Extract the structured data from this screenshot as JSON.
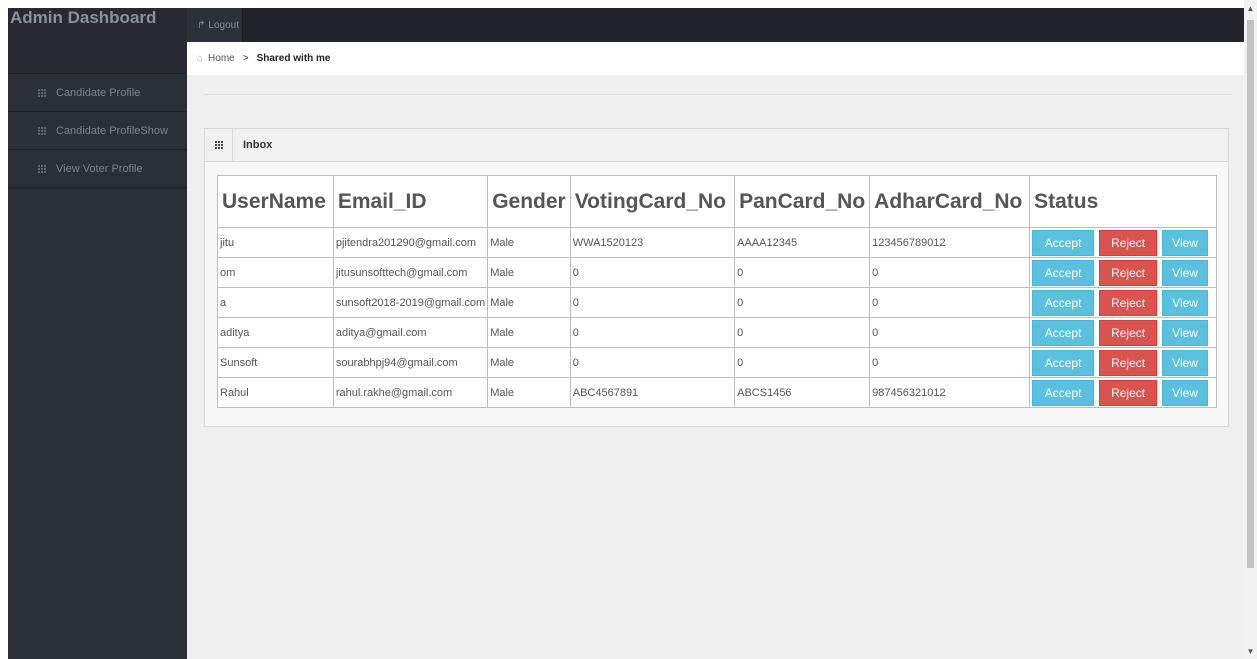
{
  "brand": {
    "title": "Admin Dashboard"
  },
  "topbar": {
    "logout_label": "Logout"
  },
  "breadcrumb": {
    "home": "Home",
    "separator": ">",
    "current": "Shared with me"
  },
  "sidebar": {
    "items": [
      {
        "label": "Candidate Profile"
      },
      {
        "label": "Candidate ProfileShow"
      },
      {
        "label": "View Voter Profile"
      }
    ]
  },
  "panel": {
    "title": "Inbox"
  },
  "table": {
    "headers": [
      "UserName",
      "Email_ID",
      "Gender",
      "VotingCard_No",
      "PanCard_No",
      "AdharCard_No",
      "Status"
    ],
    "rows": [
      {
        "username": "jitu",
        "email": "pjitendra201290@gmail.com",
        "gender": "Male",
        "voting": "WWA1520123",
        "pan": "AAAA12345",
        "adhar": "123456789012"
      },
      {
        "username": "om",
        "email": "jitusunsofttech@gmail.com",
        "gender": "Male",
        "voting": "0",
        "pan": "0",
        "adhar": "0"
      },
      {
        "username": "a",
        "email": "sunsoft2018-2019@gmail.com",
        "gender": "Male",
        "voting": "0",
        "pan": "0",
        "adhar": "0"
      },
      {
        "username": "aditya",
        "email": "aditya@gmail.com",
        "gender": "Male",
        "voting": "0",
        "pan": "0",
        "adhar": "0"
      },
      {
        "username": "Sunsoft",
        "email": "sourabhpj94@gmail.com",
        "gender": "Male",
        "voting": "0",
        "pan": "0",
        "adhar": "0"
      },
      {
        "username": "Rahul",
        "email": "rahul.rakhe@gmail.com",
        "gender": "Male",
        "voting": "ABC4567891",
        "pan": "ABCS1456",
        "adhar": "987456321012"
      }
    ],
    "actions": {
      "accept": "Accept",
      "reject": "Reject",
      "view": "View"
    }
  },
  "colors": {
    "info": "#5bc0de",
    "danger": "#d9534f",
    "sidebar": "#2b2f36",
    "topbar": "#21252b"
  },
  "icons": {
    "menu": "grid-icon",
    "home": "home-icon",
    "logout": "share-arrow-icon"
  }
}
